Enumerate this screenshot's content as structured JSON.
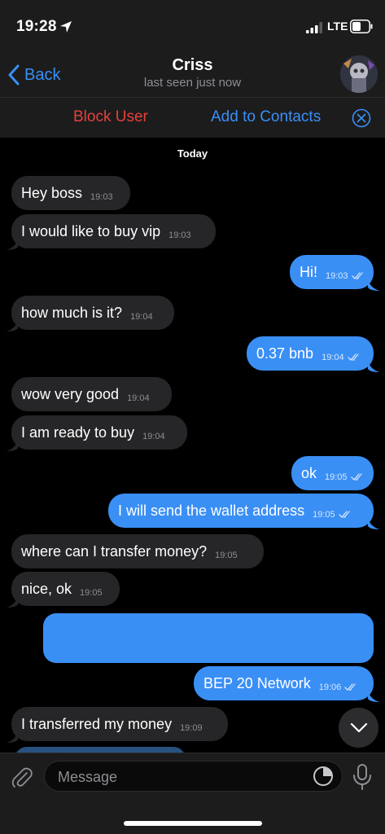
{
  "status": {
    "time": "19:28",
    "network": "LTE"
  },
  "header": {
    "back_label": "Back",
    "title": "Criss",
    "subtitle": "last seen just now"
  },
  "actions": {
    "block": "Block User",
    "add": "Add to Contacts"
  },
  "chat": {
    "date": "Today",
    "messages": [
      {
        "dir": "in",
        "text": "Hey boss",
        "time": "19:03"
      },
      {
        "dir": "in",
        "text": "I would like to buy vip",
        "time": "19:03"
      },
      {
        "dir": "out",
        "text": "Hi!",
        "time": "19:03"
      },
      {
        "dir": "in",
        "text": "how much is it?",
        "time": "19:04"
      },
      {
        "dir": "out",
        "text": "0.37 bnb",
        "time": "19:04"
      },
      {
        "dir": "in",
        "text": "wow very good",
        "time": "19:04"
      },
      {
        "dir": "in",
        "text": "I am ready to buy",
        "time": "19:04"
      },
      {
        "dir": "out",
        "text": "ok",
        "time": "19:05"
      },
      {
        "dir": "out",
        "text": "I will send the wallet address",
        "time": "19:05"
      },
      {
        "dir": "in",
        "text": "where can I transfer money?",
        "time": "19:05"
      },
      {
        "dir": "in",
        "text": "nice, ok",
        "time": "19:05"
      },
      {
        "dir": "out",
        "text": "",
        "time": ""
      },
      {
        "dir": "out",
        "text": "BEP 20 Network",
        "time": "19:06"
      },
      {
        "dir": "in",
        "text": "I transferred my money",
        "time": "19:09"
      }
    ]
  },
  "composer": {
    "placeholder": "Message"
  },
  "colors": {
    "accent": "#3a8ff5",
    "incoming_bubble": "#262628",
    "danger": "#e5413a",
    "bar": "#1c1c1d"
  },
  "icons": [
    "location-arrow-icon",
    "signal-icon",
    "battery-icon",
    "chevron-left-icon",
    "close-circle-icon",
    "double-check-icon",
    "chevron-down-icon",
    "paperclip-icon",
    "sticker-icon",
    "microphone-icon"
  ]
}
